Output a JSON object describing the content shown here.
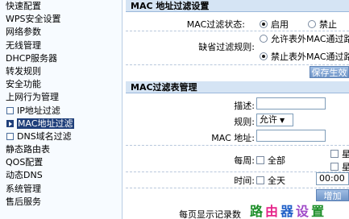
{
  "sidebar": {
    "items": [
      {
        "label": "快速配置",
        "sub": false,
        "selected": false
      },
      {
        "label": "WPS安全设置",
        "sub": false,
        "selected": false
      },
      {
        "label": "网络参数",
        "sub": false,
        "selected": false
      },
      {
        "label": "无线管理",
        "sub": false,
        "selected": false
      },
      {
        "label": "DHCP服务器",
        "sub": false,
        "selected": false
      },
      {
        "label": "转发规则",
        "sub": false,
        "selected": false
      },
      {
        "label": "安全功能",
        "sub": false,
        "selected": false
      },
      {
        "label": "上网行为管理",
        "sub": false,
        "selected": false
      },
      {
        "label": "IP地址过滤",
        "sub": true,
        "selected": false
      },
      {
        "label": "MAC地址过滤",
        "sub": true,
        "selected": true
      },
      {
        "label": "DNS域名过滤",
        "sub": true,
        "selected": false
      },
      {
        "label": "静态路由表",
        "sub": false,
        "selected": false
      },
      {
        "label": "QOS配置",
        "sub": false,
        "selected": false
      },
      {
        "label": "动态DNS",
        "sub": false,
        "selected": false
      },
      {
        "label": "系统管理",
        "sub": false,
        "selected": false
      },
      {
        "label": "售后服务",
        "sub": false,
        "selected": false
      }
    ]
  },
  "settings": {
    "title": "MAC 地址过滤设置",
    "status_label": "MAC过滤状态:",
    "enable_label": "启用",
    "disable_label": "禁止",
    "default_rule_label": "缺省过滤规则:",
    "rule_allow_label": "允许表外MAC通过路由",
    "rule_deny_label": "禁止表外MAC通过路由",
    "save_button": "保存生效"
  },
  "table": {
    "title": "MAC过滤表管理",
    "desc_label": "描述:",
    "rule_label": "规则:",
    "rule_value": "允许",
    "mac_label": "MAC 地址:",
    "week_label": "每周:",
    "all_week_label": "全部",
    "week_option_1": "星期",
    "week_option_2": "星期",
    "time_label": "时间:",
    "all_day_label": "全天",
    "time_value": "00:00",
    "add_button": "增加",
    "per_page_label": "每页显示记录数"
  },
  "watermark": {
    "c1": "路",
    "c2": "由",
    "c3": "器",
    "c4": "设",
    "c5": "置"
  },
  "colors": {
    "section_bg": "#d5e4f4",
    "button": "#6f95c8",
    "selected_nav": "#1f3f7a"
  }
}
